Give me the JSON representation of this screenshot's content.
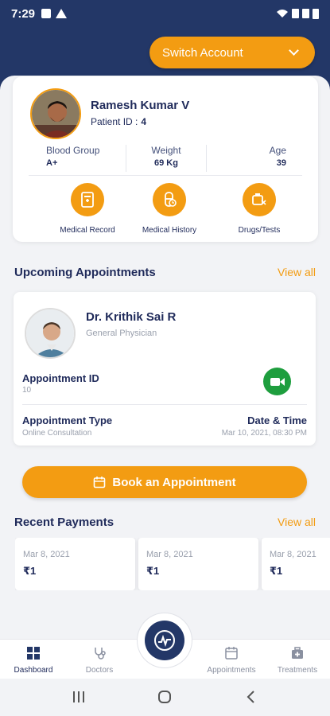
{
  "status_bar": {
    "time": "7:29"
  },
  "header": {
    "switch_account_label": "Switch Account"
  },
  "patient": {
    "name": "Ramesh Kumar V",
    "id_label": "Patient ID :",
    "id_value": "4",
    "blood_group_label": "Blood Group",
    "blood_group_value": "A+",
    "weight_label": "Weight",
    "weight_value": "69 Kg",
    "age_label": "Age",
    "age_value": "39"
  },
  "quick_actions": [
    {
      "label": "Medical Record",
      "icon": "medical-record-icon"
    },
    {
      "label": "Medical History",
      "icon": "medical-history-icon"
    },
    {
      "label": "Drugs/Tests",
      "icon": "drugs-tests-icon"
    }
  ],
  "upcoming": {
    "title": "Upcoming Appointments",
    "view_all": "View all",
    "doctor_name": "Dr. Krithik Sai R",
    "doctor_specialty": "General Physician",
    "appointment_id_label": "Appointment ID",
    "appointment_id_value": "10",
    "appointment_type_label": "Appointment Type",
    "appointment_type_value": "Online Consultation",
    "date_time_label": "Date & Time",
    "date_time_value": "Mar 10, 2021, 08:30 PM"
  },
  "book_button_label": "Book an Appointment",
  "payments": {
    "title": "Recent Payments",
    "view_all": "View all",
    "items": [
      {
        "date": "Mar 8, 2021",
        "amount": "₹1"
      },
      {
        "date": "Mar 8, 2021",
        "amount": "₹1"
      },
      {
        "date": "Mar 8, 2021",
        "amount": "₹1"
      }
    ]
  },
  "bottom_nav": {
    "items": [
      {
        "label": "Dashboard",
        "icon": "dashboard-icon"
      },
      {
        "label": "Doctors",
        "icon": "stethoscope-icon"
      },
      {
        "label": "Appointments",
        "icon": "calendar-icon"
      },
      {
        "label": "Treatments",
        "icon": "medical-kit-icon"
      }
    ]
  },
  "colors": {
    "primary": "#233767",
    "accent": "#f39c12",
    "video_call": "#1e9e3e"
  }
}
